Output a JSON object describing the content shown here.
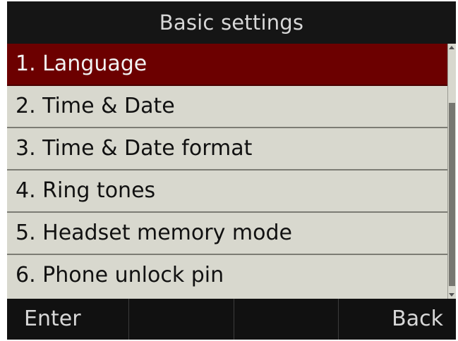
{
  "header": {
    "title": "Basic settings"
  },
  "menu": {
    "items": [
      {
        "label": "1. Language",
        "selected": true
      },
      {
        "label": "2. Time & Date",
        "selected": false
      },
      {
        "label": "3. Time & Date format",
        "selected": false
      },
      {
        "label": "4. Ring tones",
        "selected": false
      },
      {
        "label": "5. Headset memory mode",
        "selected": false
      },
      {
        "label": "6. Phone unlock pin",
        "selected": false
      }
    ]
  },
  "softkeys": {
    "key1": "Enter",
    "key2": "",
    "key3": "",
    "key4": "Back"
  },
  "colors": {
    "selection": "#6c0000",
    "list_background": "#d8d8ce",
    "bar_background": "#111111",
    "bar_text": "#d8d8d8"
  }
}
